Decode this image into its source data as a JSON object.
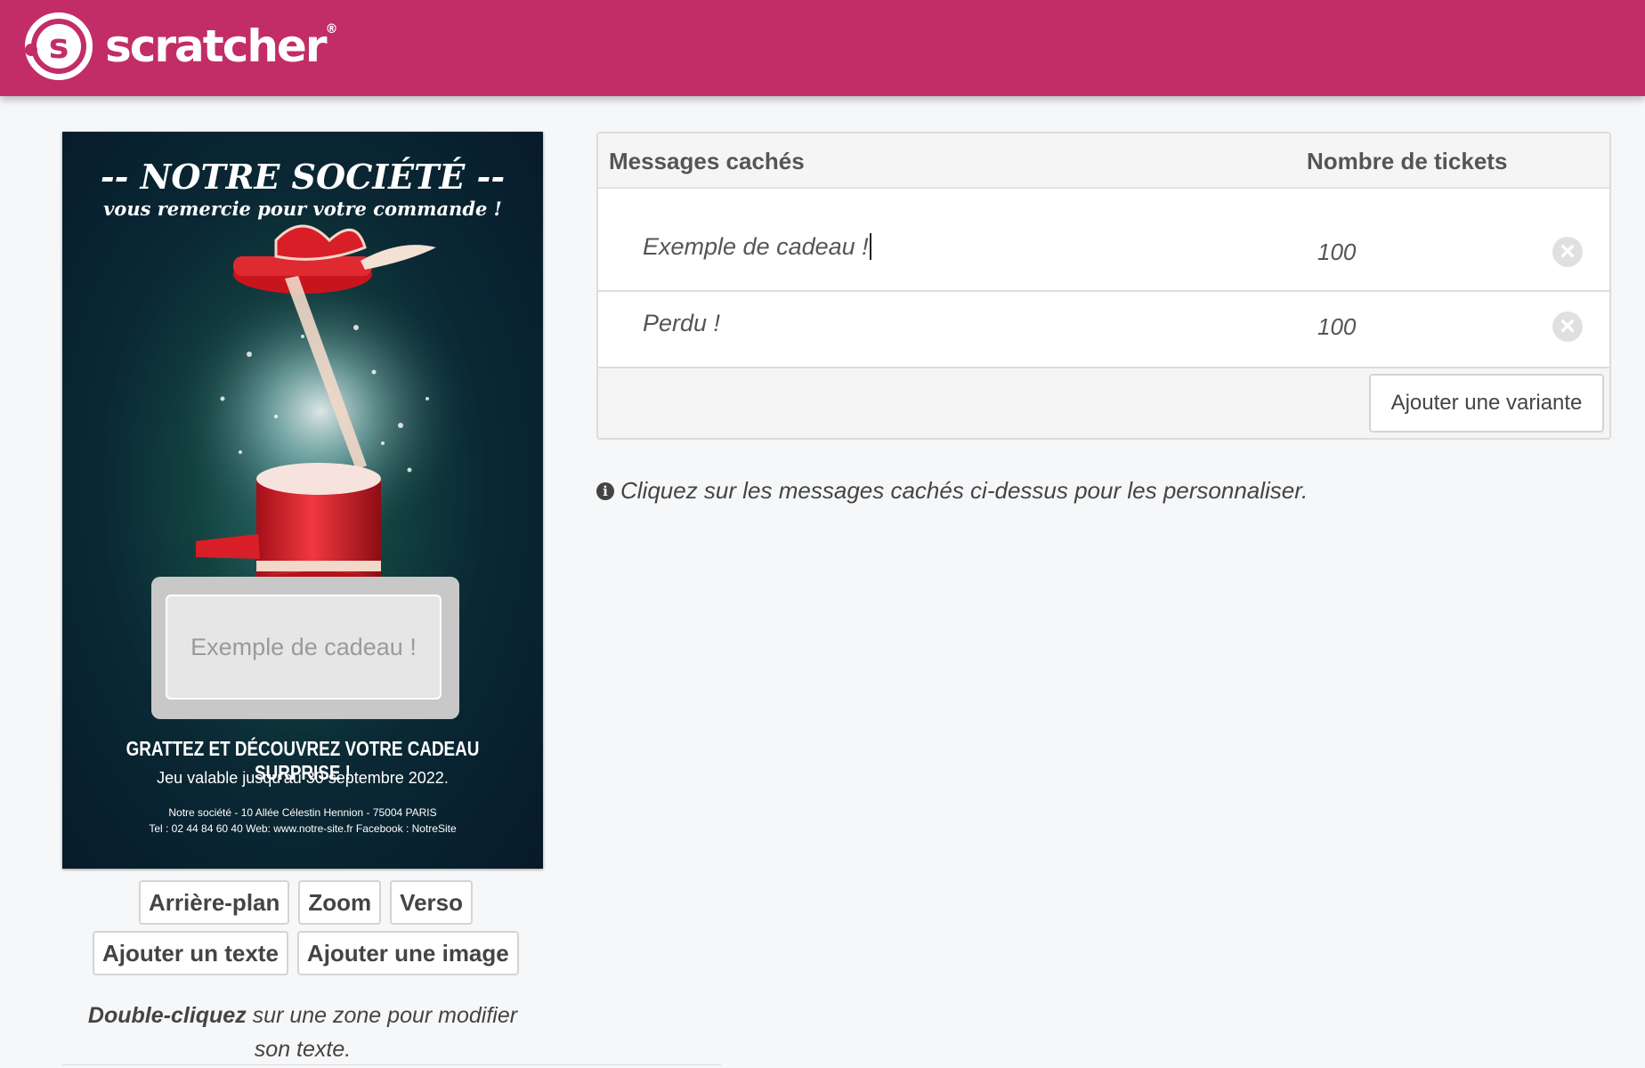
{
  "header": {
    "logo_letter": "s",
    "logo_text": "scratcher",
    "logo_reg": "®"
  },
  "ticket": {
    "title": "-- NOTRE SOCIÉTÉ --",
    "subtitle": "vous remercie pour votre commande !",
    "scratch_text": "Exemple de cadeau !",
    "headline": "GRATTEZ ET DÉCOUVREZ VOTRE CADEAU SURPRISE !",
    "validity": "Jeu valable jusqu'au 30 septembre 2022.",
    "address": "Notre société - 10 Allée Célestin Hennion - 75004 PARIS",
    "contact": "Tel : 02 44 84 60 40 Web: www.notre-site.fr Facebook : NotreSite"
  },
  "ticket_buttons": {
    "background": "Arrière-plan",
    "zoom": "Zoom",
    "verso": "Verso",
    "add_text": "Ajouter un texte",
    "add_image": "Ajouter une image"
  },
  "help": {
    "bold": "Double-cliquez",
    "rest": "sur une zone pour modifier son texte."
  },
  "table": {
    "col_messages": "Messages cachés",
    "col_count": "Nombre de tickets",
    "rows": [
      {
        "message": "Exemple de cadeau !",
        "count": "100"
      },
      {
        "message": "Perdu !",
        "count": "100"
      }
    ],
    "add_variant": "Ajouter une variante"
  },
  "info": {
    "icon": "i",
    "text": "Cliquez sur les messages cachés ci-dessus pour les personnaliser."
  },
  "colors": {
    "brand": "#c22d67",
    "ticket_bg": "#0a2834"
  }
}
